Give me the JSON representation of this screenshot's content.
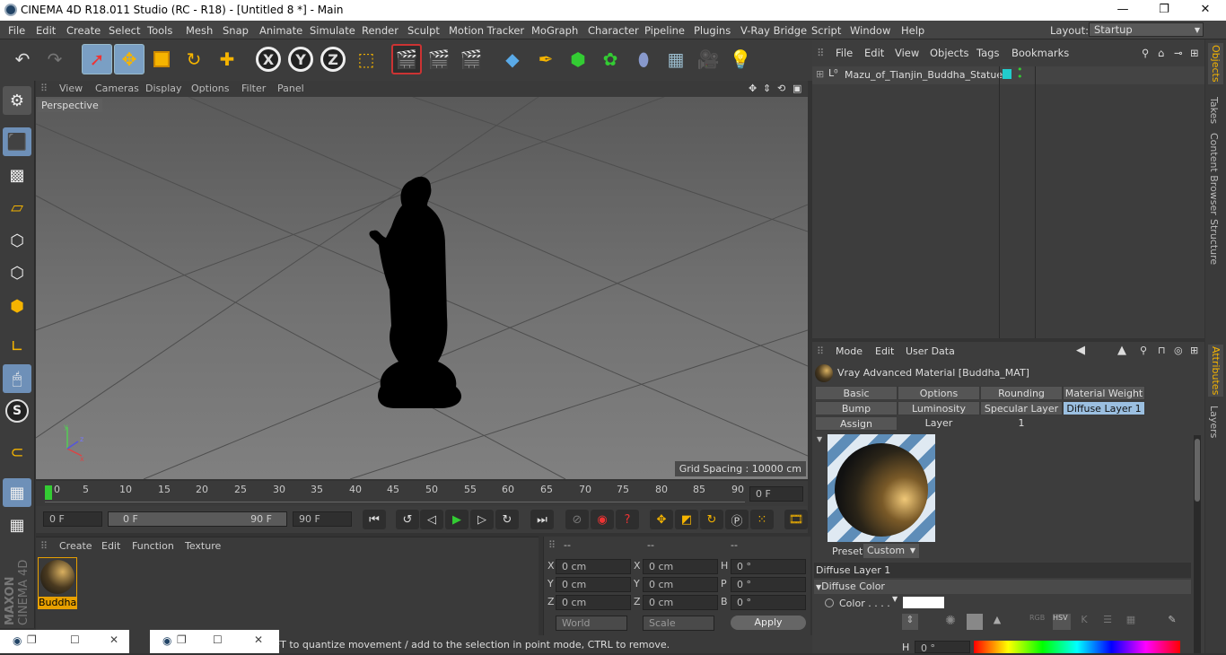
{
  "window": {
    "title": "CINEMA 4D R18.011 Studio (RC - R18) - [Untitled 8 *] - Main",
    "min": "—",
    "max": "❐",
    "close": "✕"
  },
  "menubar": {
    "items": [
      "File",
      "Edit",
      "Create",
      "Select",
      "Tools",
      "Mesh",
      "Snap",
      "Animate",
      "Simulate",
      "Render",
      "Sculpt",
      "Motion Tracker",
      "MoGraph",
      "Character",
      "Pipeline",
      "Plugins",
      "V-Ray Bridge",
      "Script",
      "Window",
      "Help"
    ],
    "layout_label": "Layout:",
    "layout_value": "Startup"
  },
  "toolbar": {
    "axis_x": "X",
    "axis_y": "Y",
    "axis_z": "Z"
  },
  "viewport": {
    "menu": [
      "View",
      "Cameras",
      "Display",
      "Options",
      "Filter",
      "Panel"
    ],
    "label": "Perspective",
    "grid_spacing": "Grid Spacing : 10000 cm"
  },
  "timeline": {
    "ticks": [
      "0",
      "5",
      "10",
      "15",
      "20",
      "25",
      "30",
      "35",
      "40",
      "45",
      "50",
      "55",
      "60",
      "65",
      "70",
      "75",
      "80",
      "85",
      "90"
    ],
    "frame_field": "0 F",
    "start": "0 F",
    "range_start": "0 F",
    "range_end": "90 F",
    "end": "90 F"
  },
  "material_manager": {
    "menu": [
      "Create",
      "Edit",
      "Function",
      "Texture"
    ],
    "materials": [
      {
        "name": "Buddha"
      }
    ]
  },
  "coordinates": {
    "headers": [
      "--",
      "--",
      "--"
    ],
    "rows": [
      {
        "a": "X",
        "av": "0 cm",
        "b": "X",
        "bv": "0 cm",
        "c": "H",
        "cv": "0 °"
      },
      {
        "a": "Y",
        "av": "0 cm",
        "b": "Y",
        "bv": "0 cm",
        "c": "P",
        "cv": "0 °"
      },
      {
        "a": "Z",
        "av": "0 cm",
        "b": "Z",
        "bv": "0 cm",
        "c": "B",
        "cv": "0 °"
      }
    ],
    "mode": "World",
    "scale": "Scale",
    "apply": "Apply"
  },
  "objects": {
    "menu": [
      "File",
      "Edit",
      "View",
      "Objects",
      "Tags",
      "Bookmarks"
    ],
    "item": "Mazu_of_Tianjin_Buddha_Statue"
  },
  "attributes": {
    "menu": [
      "Mode",
      "Edit",
      "User Data"
    ],
    "material_title": "Vray Advanced Material [Buddha_MAT]",
    "tabs": [
      "Basic",
      "Options",
      "Rounding",
      "Material Weight",
      "Bump",
      "Luminosity Layer",
      "Specular Layer 1",
      "Diffuse Layer 1",
      "Assign"
    ],
    "active_tab": "Diffuse Layer 1",
    "preset_label": "Preset",
    "preset_value": "Custom",
    "section": "Diffuse Layer 1",
    "subsection": "Diffuse Color",
    "color_label": "Color . . . .",
    "h_label": "H",
    "h_value": "0 °"
  },
  "right_tabs": [
    "Objects",
    "Takes",
    "Content Browser",
    "Structure",
    "Attributes",
    "Layers"
  ],
  "status": {
    "text": "FT to quantize movement / add to the selection in point mode, CTRL to remove."
  },
  "brand": {
    "line1": "MAXON",
    "line2": "CINEMA 4D"
  }
}
